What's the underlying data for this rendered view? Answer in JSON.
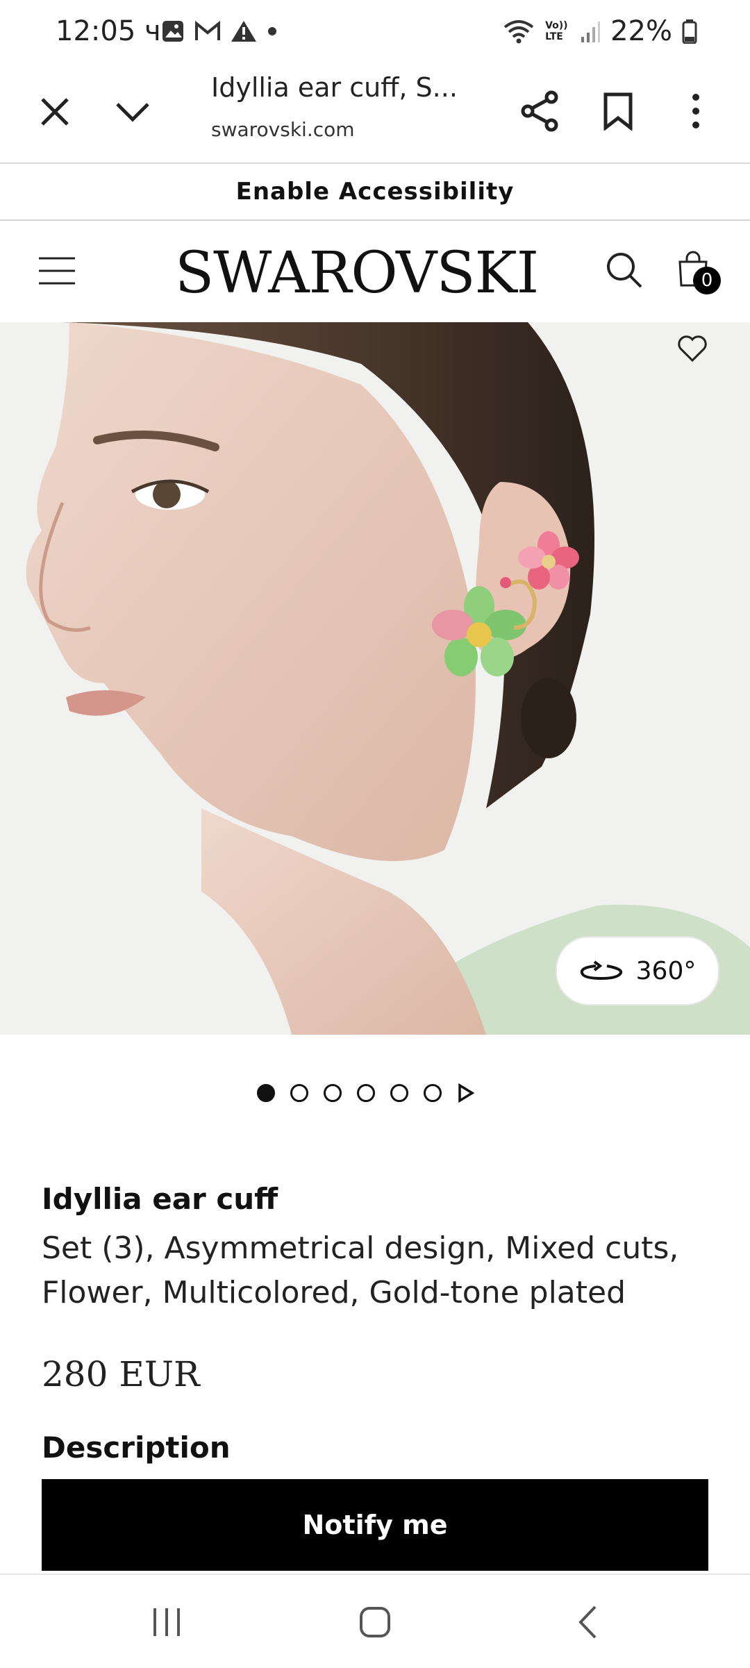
{
  "status_bar": {
    "time": "12:05 ч.",
    "battery": "22%",
    "volte": "Vo)) LTE"
  },
  "browser": {
    "page_title": "Idyllia ear cuff, S...",
    "page_url": "swarovski.com"
  },
  "banner": {
    "accessibility_label": "Enable Accessibility"
  },
  "header": {
    "logo": "SWAROVSKI",
    "cart_count": "0"
  },
  "gallery": {
    "view_360_label": "360°",
    "image_count": 6,
    "active_index": 0
  },
  "product": {
    "name": "Idyllia ear cuff",
    "subtitle": "Set (3), Asymmetrical design, Mixed cuts, Flower, Multicolored, Gold-tone plated",
    "price": "280 EUR",
    "description_heading": "Description",
    "notify_label": "Notify me"
  },
  "icons": {
    "close": "close-icon",
    "collapse": "chevron-down-icon",
    "share": "share-icon",
    "bookmark": "bookmark-icon",
    "more": "more-vert-icon",
    "menu": "hamburger-menu-icon",
    "search": "search-icon",
    "cart": "shopping-bag-icon",
    "wishlist": "heart-icon"
  }
}
